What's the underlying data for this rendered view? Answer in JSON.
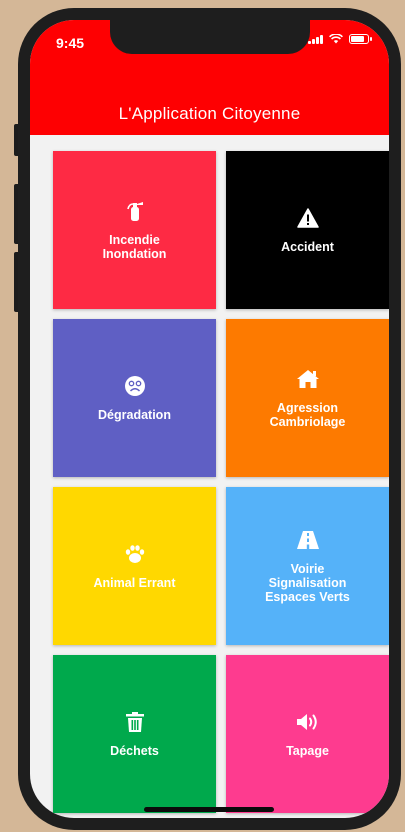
{
  "status_bar": {
    "time": "9:45"
  },
  "header": {
    "title": "L'Application Citoyenne",
    "color": "#fe0002"
  },
  "tiles": [
    {
      "label": "Incendie\nInondation",
      "icon": "fire-extinguisher-icon",
      "color": "#fe2a44"
    },
    {
      "label": "Accident",
      "icon": "warning-icon",
      "color": "#000000"
    },
    {
      "label": "Dégradation",
      "icon": "sad-face-icon",
      "color": "#5f5fc4"
    },
    {
      "label": "Agression\nCambriolage",
      "icon": "home-icon",
      "color": "#fd7a00"
    },
    {
      "label": "Animal Errant",
      "icon": "paw-icon",
      "color": "#ffd800"
    },
    {
      "label": "Voirie\nSignalisation\nEspaces Verts",
      "icon": "road-icon",
      "color": "#55b2f9"
    },
    {
      "label": "Déchets",
      "icon": "trash-icon",
      "color": "#00a94c"
    },
    {
      "label": "Tapage",
      "icon": "volume-icon",
      "color": "#fe3b8f"
    }
  ]
}
